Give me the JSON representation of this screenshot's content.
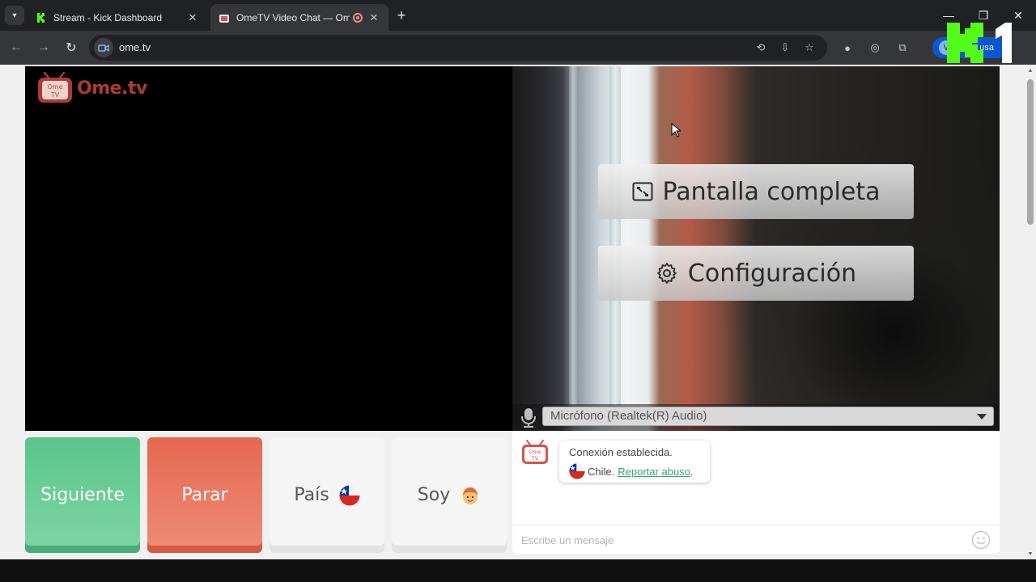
{
  "browser": {
    "tabs": [
      {
        "title": "Stream - Kick Dashboard",
        "active": false
      },
      {
        "title": "OmeTV Video Chat — Ome",
        "active": true
      }
    ],
    "url": "ome.tv",
    "profile_initial": "V",
    "profile_label": "usa"
  },
  "page": {
    "logo_text": "Ome.tv",
    "logo_badge_top": "Ome",
    "logo_badge_bottom": "TV",
    "overlay": {
      "fullscreen_label": "Pantalla completa",
      "settings_label": "Configuración"
    },
    "microphone": {
      "selected": "Micrófono (Realtek(R) Audio)"
    },
    "controls": {
      "next_label": "Siguiente",
      "stop_label": "Parar",
      "country_label": "País",
      "gender_label": "Soy"
    },
    "chat": {
      "system_message": "Conexión establecida.",
      "country": "Chile.",
      "report_link": "Reportar abuso",
      "report_suffix": ".",
      "input_placeholder": "Escribe un mensaje"
    }
  },
  "colors": {
    "next": "#5cc48b",
    "stop": "#e56850",
    "link": "#3aa17a",
    "kick_green": "#53fc18"
  }
}
